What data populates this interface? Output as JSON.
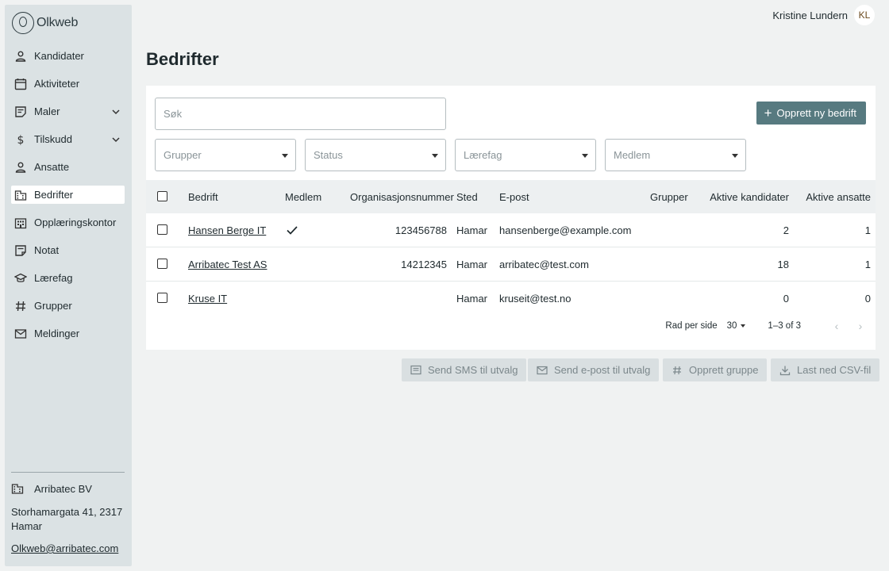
{
  "app": {
    "name": "Olkweb"
  },
  "user": {
    "name": "Kristine Lundern",
    "initials": "KL"
  },
  "sidebar": {
    "items": [
      {
        "label": "Kandidater",
        "icon": "person-icon"
      },
      {
        "label": "Aktiviteter",
        "icon": "calendar-icon"
      },
      {
        "label": "Maler",
        "icon": "template-icon"
      },
      {
        "label": "Tilskudd",
        "icon": "dollar-icon"
      },
      {
        "label": "Ansatte",
        "icon": "person-icon"
      },
      {
        "label": "Bedrifter",
        "icon": "building-icon",
        "active": true
      },
      {
        "label": "Opplæringskontor",
        "icon": "office-icon"
      },
      {
        "label": "Notat",
        "icon": "note-icon"
      },
      {
        "label": "Lærefag",
        "icon": "school-icon"
      },
      {
        "label": "Grupper",
        "icon": "hash-icon"
      },
      {
        "label": "Meldinger",
        "icon": "mail-icon"
      }
    ],
    "org": "Arribatec BV",
    "address": "Storhamargata 41, 2317 Hamar",
    "email": "Olkweb@arribatec.com"
  },
  "page": {
    "title": "Bedrifter"
  },
  "filters": {
    "search_placeholder": "Søk",
    "create_button": "Opprett ny bedrift",
    "selects": [
      "Grupper",
      "Status",
      "Lærefag",
      "Medlem"
    ]
  },
  "table": {
    "headers": {
      "company": "Bedrift",
      "member": "Medlem",
      "orgnr": "Organisasjonsnummer",
      "place": "Sted",
      "email": "E-post",
      "groups": "Grupper",
      "active_candidates": "Aktive kandidater",
      "active_employees": "Aktive ansatte"
    },
    "rows": [
      {
        "company": "Hansen Berge IT",
        "member": true,
        "orgnr": "123456788",
        "place": "Hamar",
        "email": "hansenberge@example.com",
        "groups": "",
        "active_candidates": "2",
        "active_employees": "1"
      },
      {
        "company": "Arribatec Test AS",
        "member": false,
        "orgnr": "14212345",
        "place": "Hamar",
        "email": "arribatec@test.com",
        "groups": "",
        "active_candidates": "18",
        "active_employees": "1"
      },
      {
        "company": "Kruse IT",
        "member": false,
        "orgnr": "",
        "place": "Hamar",
        "email": "kruseit@test.no",
        "groups": "",
        "active_candidates": "0",
        "active_employees": "0"
      }
    ]
  },
  "pagination": {
    "rows_per_page_label": "Rad per side",
    "rows_per_page": "30",
    "range": "1–3 of 3"
  },
  "actions": {
    "sms": "Send SMS til utvalg",
    "email": "Send e-post til utvalg",
    "group": "Opprett gruppe",
    "csv": "Last ned CSV-fil"
  },
  "colors": {
    "primary": "#577a80",
    "sidebar": "#dbe2e4",
    "background": "#f0f2f2"
  }
}
